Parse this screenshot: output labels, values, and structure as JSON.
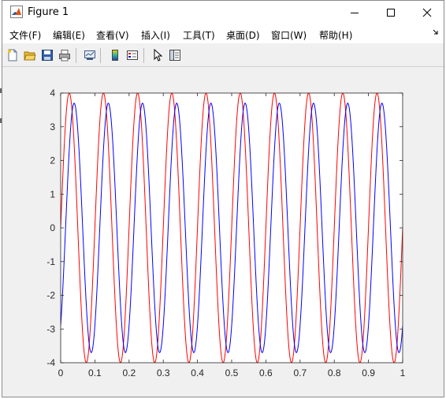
{
  "window": {
    "title": "Figure 1",
    "app_icon": "matlab-logo-icon",
    "controls": [
      "minimize-icon",
      "maximize-icon",
      "close-icon"
    ]
  },
  "menu": {
    "items": [
      {
        "label": "文件(F)"
      },
      {
        "label": "编辑(E)"
      },
      {
        "label": "查看(V)"
      },
      {
        "label": "插入(I)"
      },
      {
        "label": "工具(T)"
      },
      {
        "label": "桌面(D)"
      },
      {
        "label": "窗口(W)"
      },
      {
        "label": "帮助(H)"
      }
    ],
    "dock_icon": "dock-arrow-icon"
  },
  "toolbar": {
    "buttons": [
      "new-figure-icon",
      "open-file-icon",
      "save-icon",
      "print-icon",
      "link-plot-icon",
      "insert-colorbar-icon",
      "insert-legend-icon",
      "edit-plot-icon",
      "property-editor-icon"
    ]
  },
  "chart_data": {
    "type": "line",
    "title": "",
    "xlabel": "",
    "ylabel": "",
    "xlim": [
      0,
      1
    ],
    "ylim": [
      -4,
      4
    ],
    "xticks": [
      "0",
      "0.1",
      "0.2",
      "0.3",
      "0.4",
      "0.5",
      "0.6",
      "0.7",
      "0.8",
      "0.9",
      "1"
    ],
    "yticks": [
      "4",
      "3",
      "2",
      "1",
      "0",
      "-1",
      "-2",
      "-3",
      "-4"
    ],
    "grid": false,
    "series": [
      {
        "color": "#ff0000",
        "function": "4*sin(2*pi*10*t)",
        "amplitude": 4,
        "frequency": 10,
        "phase": 0
      },
      {
        "color": "#0000ff",
        "function": "3.7*sin(2*pi*10*t - 0.9)",
        "amplitude": 3.7,
        "frequency": 10,
        "phase": -0.9
      }
    ]
  }
}
